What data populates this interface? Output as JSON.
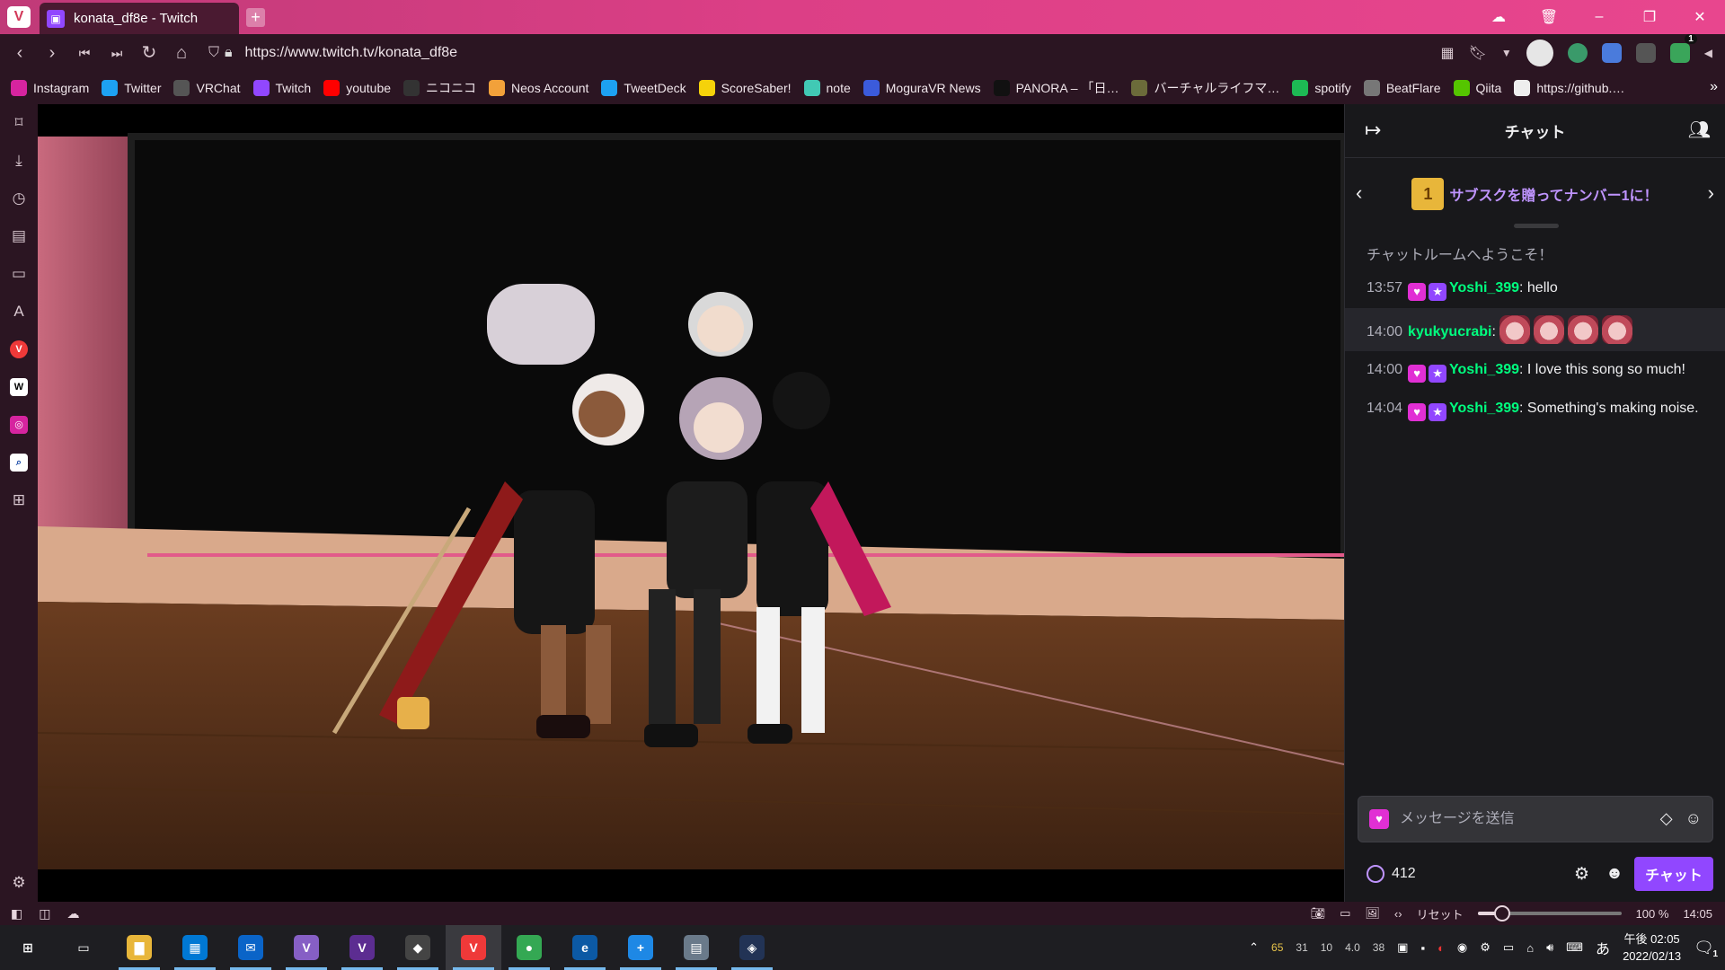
{
  "browser": {
    "tab_title": "konata_df8e - Twitch",
    "url": "https://www.twitch.tv/konata_df8e",
    "new_tab_symbol": "+",
    "window_controls": [
      "☁",
      "🗑",
      "–",
      "❐",
      "✕"
    ],
    "extension_badge": "1"
  },
  "bookmarks": [
    {
      "label": "Instagram",
      "icon": "instagram-icon",
      "color": "#d6249f"
    },
    {
      "label": "Twitter",
      "icon": "twitter-icon",
      "color": "#1da1f2"
    },
    {
      "label": "VRChat",
      "icon": "vrchat-icon",
      "color": "#555555"
    },
    {
      "label": "Twitch",
      "icon": "twitch-icon",
      "color": "#9147ff"
    },
    {
      "label": "youtube",
      "icon": "youtube-icon",
      "color": "#ff0000"
    },
    {
      "label": "ニコニコ",
      "icon": "niconico-icon",
      "color": "#333333"
    },
    {
      "label": "Neos Account",
      "icon": "neos-icon",
      "color": "#f2a13a"
    },
    {
      "label": "TweetDeck",
      "icon": "tweetdeck-icon",
      "color": "#1da1f2"
    },
    {
      "label": "ScoreSaber!",
      "icon": "scoresaber-icon",
      "color": "#f5d20a"
    },
    {
      "label": "note",
      "icon": "note-icon",
      "color": "#41c9b4"
    },
    {
      "label": "MoguraVR News",
      "icon": "moguravr-icon",
      "color": "#3b5bdb"
    },
    {
      "label": "PANORA – 「日…",
      "icon": "panora-icon",
      "color": "#111111"
    },
    {
      "label": "バーチャルライフマ…",
      "icon": "virtuallife-icon",
      "color": "#6b6b3a"
    },
    {
      "label": "spotify",
      "icon": "spotify-icon",
      "color": "#1db954"
    },
    {
      "label": "BeatFlare",
      "icon": "beatflare-icon",
      "color": "#777777"
    },
    {
      "label": "Qiita",
      "icon": "qiita-icon",
      "color": "#55c500"
    },
    {
      "label": "https://github.…",
      "icon": "github-icon",
      "color": "#eeeeee"
    }
  ],
  "chat": {
    "title": "チャット",
    "promo_text": "サブスクを贈ってナンバー1に！",
    "promo_gift_number": "1",
    "welcome": "チャットルームへようこそ！",
    "messages": [
      {
        "time": "13:57",
        "user": "Yoshi_399",
        "user_color": "#00ff7f",
        "text": ": hello",
        "badges": true,
        "emotes": 0
      },
      {
        "time": "14:00",
        "user": "kyukyucrabi",
        "user_color": "#00ff7f",
        "text": ":",
        "badges": false,
        "emotes": 4
      },
      {
        "time": "14:00",
        "user": "Yoshi_399",
        "user_color": "#00ff7f",
        "text": ": I love this song so much!",
        "badges": true,
        "emotes": 0
      },
      {
        "time": "14:04",
        "user": "Yoshi_399",
        "user_color": "#00ff7f",
        "text": ": Something's making noise.",
        "badges": true,
        "emotes": 0
      }
    ],
    "input_placeholder": "メッセージを送信",
    "points": "412",
    "send_label": "チャット"
  },
  "statusbar": {
    "reset_label": "リセット",
    "zoom": "100 %",
    "zoom_fraction": 0.17,
    "time": "14:05"
  },
  "taskbar": {
    "apps": [
      {
        "name": "windows-start",
        "glyph": "⊞",
        "color": "#1e1e22"
      },
      {
        "name": "task-view",
        "glyph": "▭",
        "color": "#1e1e22"
      },
      {
        "name": "file-explorer",
        "glyph": "▇",
        "color": "#e8b63a"
      },
      {
        "name": "microsoft-store",
        "glyph": "▦",
        "color": "#0078d4"
      },
      {
        "name": "mail",
        "glyph": "✉",
        "color": "#0a64c8"
      },
      {
        "name": "visual-studio",
        "glyph": "V",
        "color": "#865fc5"
      },
      {
        "name": "visual-studio-2",
        "glyph": "V",
        "color": "#5c2d91"
      },
      {
        "name": "unity",
        "glyph": "◆",
        "color": "#444444"
      },
      {
        "name": "vivaldi",
        "glyph": "V",
        "color": "#ef3939",
        "active": true
      },
      {
        "name": "chrome",
        "glyph": "●",
        "color": "#34a853"
      },
      {
        "name": "edge",
        "glyph": "e",
        "color": "#0c59a4"
      },
      {
        "name": "app-blue",
        "glyph": "+",
        "color": "#1e88e5"
      },
      {
        "name": "app-window",
        "glyph": "▤",
        "color": "#6a7a8a"
      },
      {
        "name": "app-dark",
        "glyph": "◈",
        "color": "#223355"
      }
    ],
    "tray_numbers": [
      "65",
      "31",
      "10",
      "4.0",
      "38"
    ],
    "ime": "あ",
    "clock_time": "午後 02:05",
    "clock_date": "2022/02/13",
    "notification_count": "1"
  }
}
